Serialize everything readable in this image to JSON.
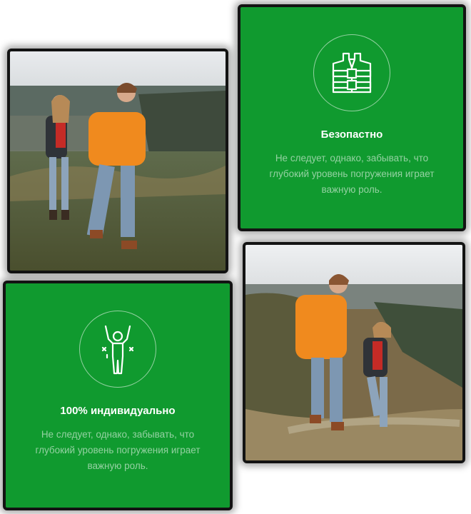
{
  "cards": {
    "safety": {
      "icon": "life-vest-icon",
      "title": "Безопастно",
      "text": "Не следует, однако, забывать, что глубокий уровень погружения играет важную роль."
    },
    "individual": {
      "icon": "person-celebrating-icon",
      "title": "100% индивидуально",
      "text": "Не следует, однако, забывать, что глубокий уровень погружения играет важную роль."
    },
    "photo_top": {
      "subject": "couple-hiking-photo"
    },
    "photo_bottom": {
      "subject": "couple-climbing-hill-photo"
    }
  },
  "colors": {
    "card_green": "#109a2f",
    "card_border": "#131313",
    "muted_text": "rgba(255,255,255,0.55)"
  }
}
